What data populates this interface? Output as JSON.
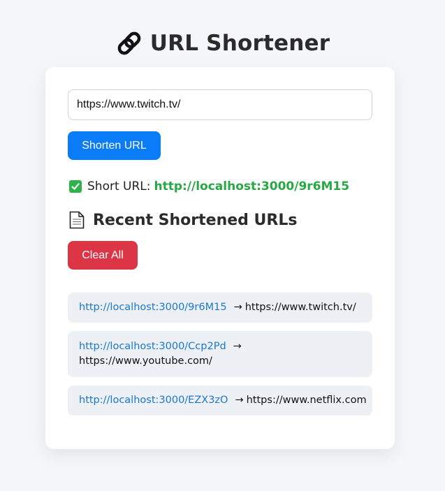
{
  "header": {
    "title": "URL Shortener",
    "icon": "link-icon"
  },
  "form": {
    "input_value": "https://www.twitch.tv/",
    "shorten_label": "Shorten URL"
  },
  "result": {
    "prefix": "Short URL:",
    "short_url": "http://localhost:3000/9r6M15",
    "icon": "check-icon"
  },
  "recent": {
    "title": "Recent Shortened URLs",
    "icon": "document-icon",
    "clear_label": "Clear All",
    "arrow": "→",
    "items": [
      {
        "short": "http://localhost:3000/9r6M15",
        "original": "https://www.twitch.tv/"
      },
      {
        "short": "http://localhost:3000/Ccp2Pd",
        "original": "https://www.youtube.com/"
      },
      {
        "short": "http://localhost:3000/EZX3zO",
        "original": "https://www.netflix.com"
      }
    ]
  },
  "colors": {
    "primary": "#0a7cf7",
    "danger": "#dc3545",
    "success": "#28a745",
    "link": "#1a78d2",
    "item_bg": "#edf0f4",
    "page_bg": "#f4f6fa"
  }
}
